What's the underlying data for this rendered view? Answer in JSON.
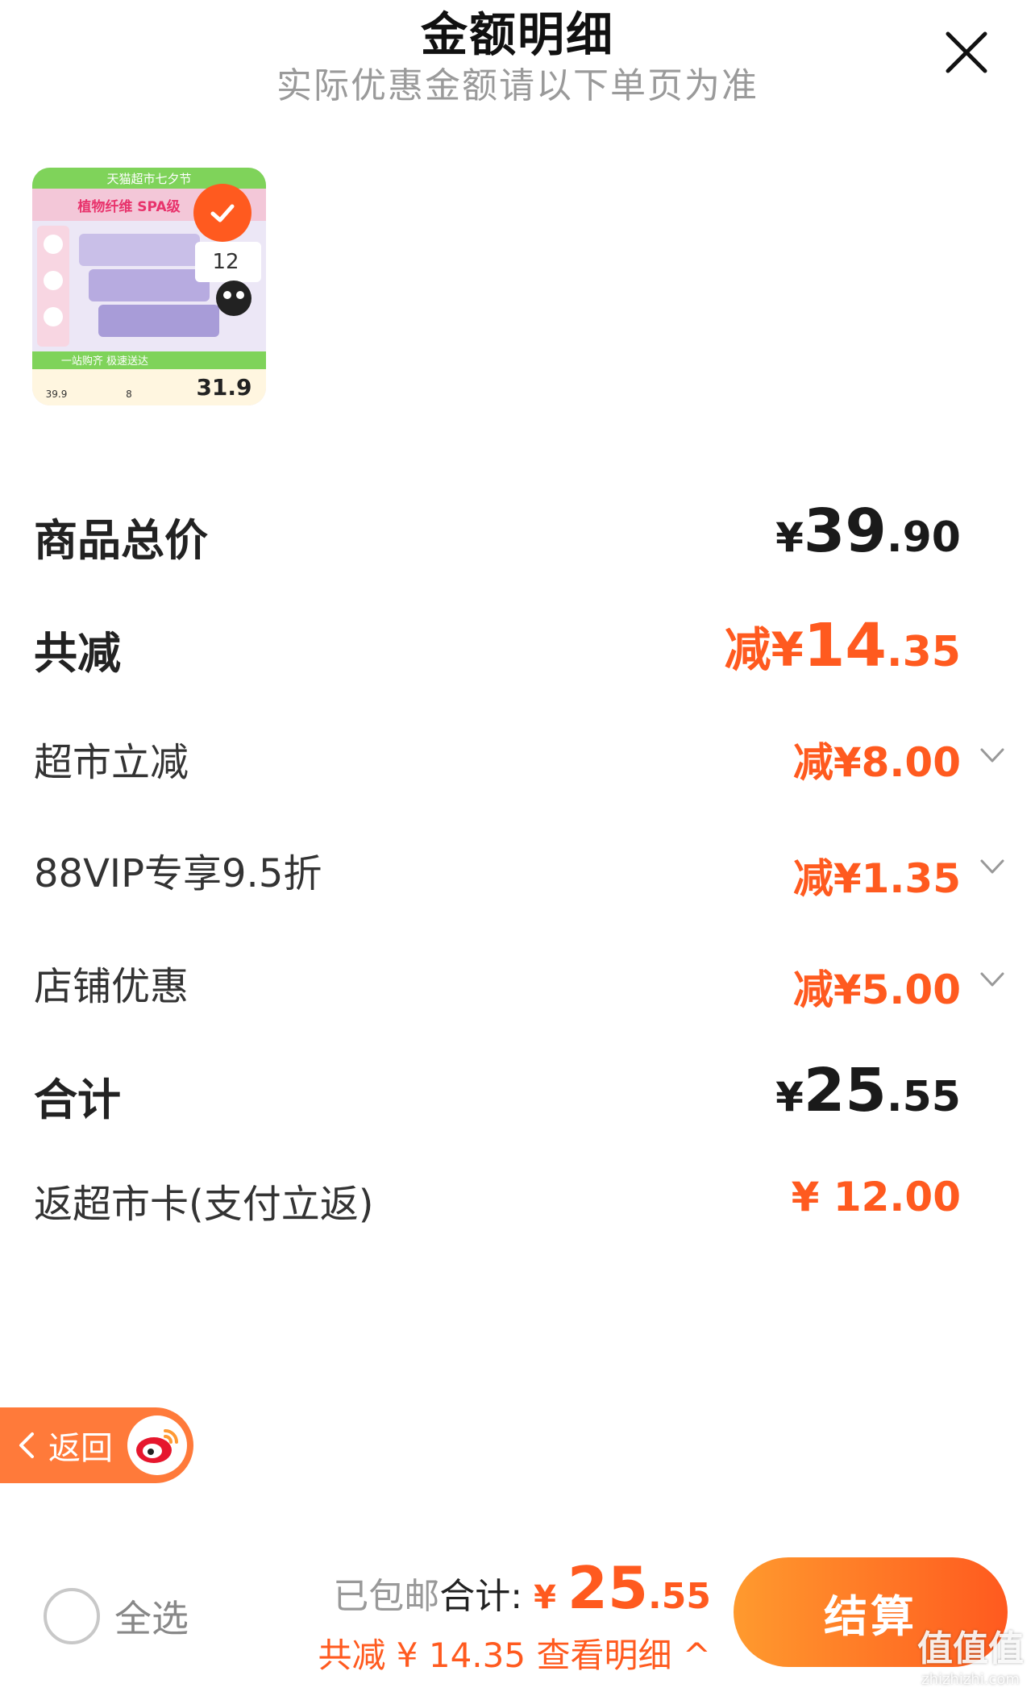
{
  "header": {
    "title": "金额明细",
    "subtitle": "实际优惠金额请以下单页为准"
  },
  "product": {
    "banner_text": "天猫超市七夕节",
    "headline": "植物纤维 SPA级",
    "gift_amount": "12",
    "campaign": "一站购齐 极速送达",
    "promo_price": "31.9",
    "orig_price": "39.9",
    "card_amount": "8"
  },
  "rows": [
    {
      "label": "商品总价",
      "sym": "¥",
      "int": "39",
      "dec": ".90"
    },
    {
      "label": "共减",
      "sym": "减¥",
      "int": "14",
      "dec": ".35"
    },
    {
      "label": "超市立减",
      "value": "减¥8.00"
    },
    {
      "label": "88VIP专享9.5折",
      "value": "减¥1.35"
    },
    {
      "label": "店铺优惠",
      "value": "减¥5.00"
    },
    {
      "label": "合计",
      "sym": "¥",
      "int": "25",
      "dec": ".55"
    },
    {
      "label": "返超市卡(支付立返)",
      "value": "¥ 12.00"
    }
  ],
  "back_button": {
    "label": "返回"
  },
  "bottom_bar": {
    "select_all": "全选",
    "shipped": "已包邮",
    "total_label": "合计: ",
    "currency": "¥ ",
    "total_int": "25",
    "total_dec": ".55",
    "discount_text": "共减 ¥ 14.35  查看明细 ^",
    "checkout_label": "结算"
  },
  "watermark": {
    "main": "值值值",
    "sub": "zhizhizhi.com"
  },
  "colors": {
    "accent": "#ff5a1f",
    "accent_light": "#ff9a2e"
  }
}
